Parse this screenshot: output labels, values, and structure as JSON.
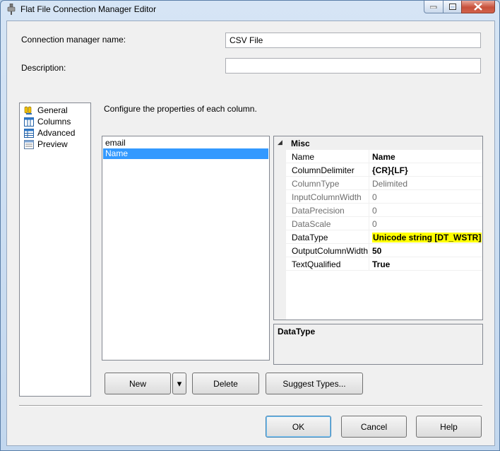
{
  "window": {
    "title": "Flat File Connection Manager Editor"
  },
  "form": {
    "connection_name_label": "Connection manager name:",
    "connection_name_value": "CSV File",
    "description_label": "Description:",
    "description_value": ""
  },
  "nav": {
    "items": [
      {
        "label": "General",
        "icon": "general-icon"
      },
      {
        "label": "Columns",
        "icon": "columns-icon"
      },
      {
        "label": "Advanced",
        "icon": "advanced-icon"
      },
      {
        "label": "Preview",
        "icon": "preview-icon"
      }
    ],
    "selected": "Advanced"
  },
  "main": {
    "instruction": "Configure the properties of each column.",
    "columns": [
      "email",
      "Name"
    ],
    "selected_column": "Name"
  },
  "propgrid": {
    "category": "Misc",
    "category_toggle": "◢",
    "rows": [
      {
        "name": "Name",
        "value": "Name",
        "bold": true,
        "enabled": true
      },
      {
        "name": "ColumnDelimiter",
        "value": "{CR}{LF}",
        "bold": true,
        "enabled": true
      },
      {
        "name": "ColumnType",
        "value": "Delimited",
        "bold": false,
        "enabled": false
      },
      {
        "name": "InputColumnWidth",
        "value": "0",
        "bold": false,
        "enabled": false
      },
      {
        "name": "DataPrecision",
        "value": "0",
        "bold": false,
        "enabled": false
      },
      {
        "name": "DataScale",
        "value": "0",
        "bold": false,
        "enabled": false
      },
      {
        "name": "DataType",
        "value": "Unicode string [DT_WSTR]",
        "bold": true,
        "enabled": true,
        "highlight": "#ffff00"
      },
      {
        "name": "OutputColumnWidth",
        "value": "50",
        "bold": true,
        "enabled": true
      },
      {
        "name": "TextQualified",
        "value": "True",
        "bold": true,
        "enabled": true
      }
    ],
    "description_title": "DataType"
  },
  "buttons": {
    "new": "New",
    "new_dropdown": "▾",
    "delete": "Delete",
    "suggest": "Suggest Types...",
    "ok": "OK",
    "cancel": "Cancel",
    "help": "Help"
  },
  "colors": {
    "selection": "#3399ff",
    "highlight": "#ffff00",
    "disabled_text": "#6d6d6d"
  }
}
